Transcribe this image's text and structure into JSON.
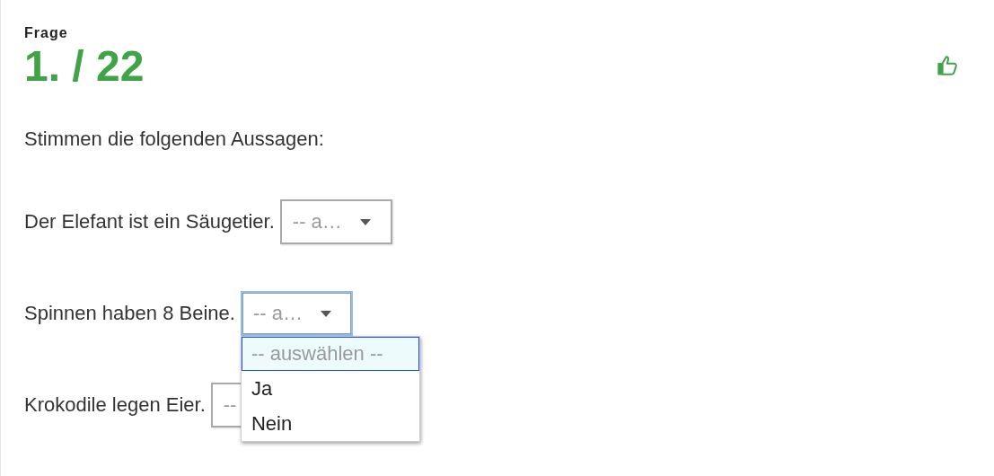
{
  "header": {
    "label": "Frage",
    "number": "1. / 22"
  },
  "intro": "Stimmen die folgenden Aussagen:",
  "statements": [
    {
      "text": "Der Elefant ist ein Säugetier.",
      "select": {
        "shown": "-- a…",
        "focused": false
      }
    },
    {
      "text": "Spinnen haben 8 Beine.",
      "select": {
        "shown": "-- a…",
        "focused": true,
        "options": [
          {
            "label": "-- auswählen --",
            "placeholder": true,
            "selected": true
          },
          {
            "label": "Ja",
            "placeholder": false,
            "selected": false
          },
          {
            "label": "Nein",
            "placeholder": false,
            "selected": false
          }
        ]
      }
    },
    {
      "text": "Krokodile legen Eier.",
      "select": {
        "shown": "--",
        "focused": false
      }
    }
  ]
}
